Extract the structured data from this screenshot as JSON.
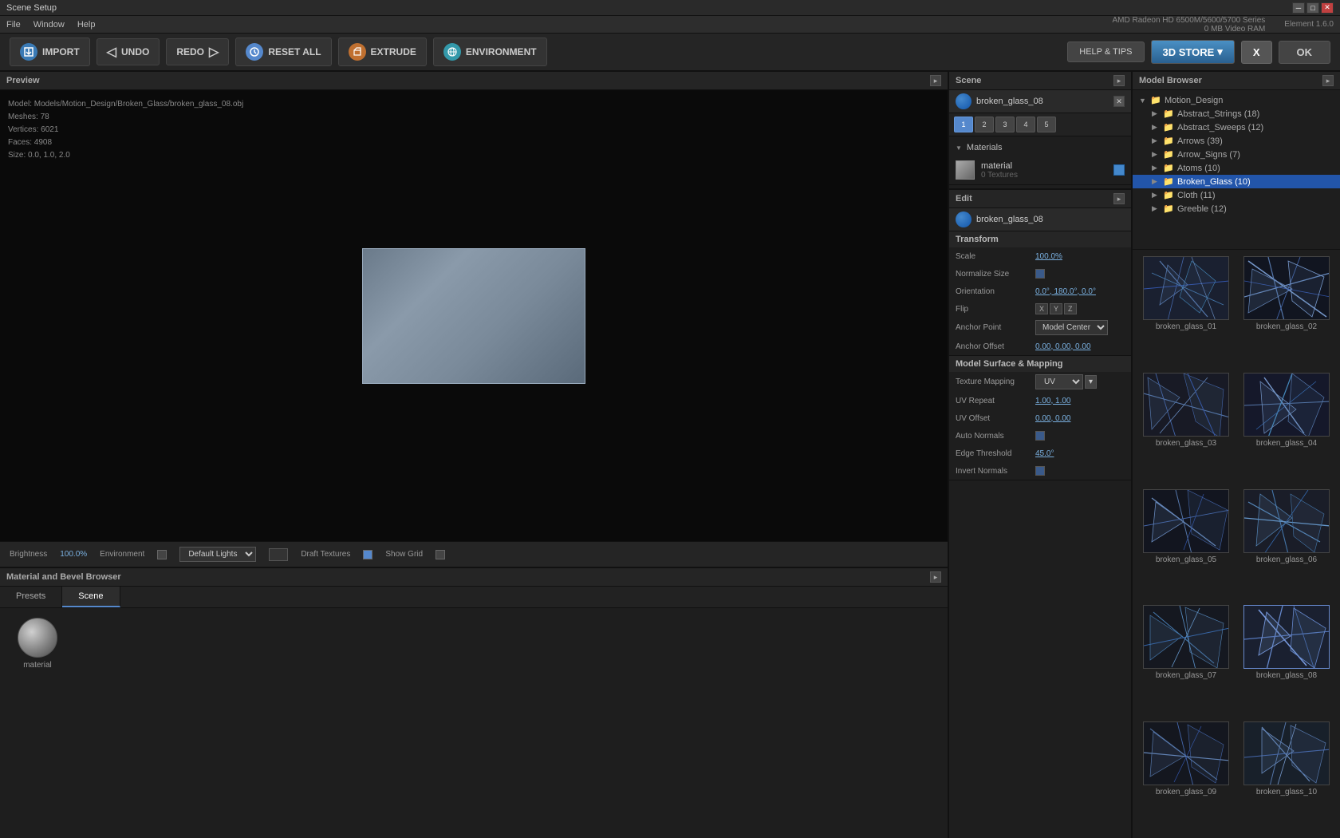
{
  "window": {
    "title": "Scene Setup",
    "gpu": "AMD Radeon HD 6500M/5600/5700 Series",
    "vram": "0 MB Video RAM",
    "element_version": "Element 1.6.0"
  },
  "menu": {
    "items": [
      "File",
      "Window",
      "Help"
    ]
  },
  "toolbar": {
    "import_label": "IMPORT",
    "undo_label": "UNDO",
    "redo_label": "REDO",
    "reset_label": "RESET ALL",
    "extrude_label": "EXTRUDE",
    "env_label": "ENVIRONMENT",
    "help_label": "HELP & TIPS",
    "store_label": "3D STORE",
    "x_label": "X",
    "ok_label": "OK"
  },
  "preview": {
    "title": "Preview",
    "model_path": "Model: Models/Motion_Design/Broken_Glass/broken_glass_08.obj",
    "meshes": "Meshes: 78",
    "vertices": "Vertices: 6021",
    "faces": "Faces: 4908",
    "size": "Size: 0.0, 1.0, 2.0",
    "brightness_label": "Brightness",
    "brightness_value": "100.0%",
    "environment_label": "Environment",
    "lights_value": "Default Lights",
    "draft_textures_label": "Draft Textures",
    "show_grid_label": "Show Grid"
  },
  "material_browser": {
    "title": "Material and Bevel Browser",
    "tabs": [
      "Presets",
      "Scene"
    ],
    "active_tab": "Scene",
    "material_name": "material"
  },
  "scene": {
    "title": "Scene",
    "object_name": "broken_glass_08",
    "tabs": [
      "1",
      "2",
      "3",
      "4",
      "5"
    ],
    "active_tab": "1",
    "materials_label": "Materials",
    "material_name": "material",
    "material_textures": "0 Textures"
  },
  "edit": {
    "title": "Edit",
    "object_name": "broken_glass_08",
    "transform_label": "Transform",
    "scale_label": "Scale",
    "scale_value": "100.0%",
    "normalize_label": "Normalize Size",
    "orientation_label": "Orientation",
    "orientation_value": "0.0°, 180.0°, 0.0°",
    "flip_label": "Flip",
    "flip_x": "X",
    "flip_y": "Y",
    "flip_z": "Z",
    "anchor_label": "Anchor Point",
    "anchor_value": "Model Center",
    "anchor_offset_label": "Anchor Offset",
    "anchor_offset_value": "0.00, 0.00, 0.00",
    "surface_mapping_title": "Model Surface & Mapping",
    "texture_mapping_label": "Texture Mapping",
    "texture_mapping_value": "UV",
    "uv_repeat_label": "UV Repeat",
    "uv_repeat_value": "1.00, 1.00",
    "uv_offset_label": "UV Offset",
    "uv_offset_value": "0.00, 0.00",
    "auto_normals_label": "Auto Normals",
    "edge_threshold_label": "Edge Threshold",
    "edge_threshold_value": "45.0°",
    "invert_normals_label": "Invert Normals"
  },
  "model_browser": {
    "title": "Model Browser",
    "tree": [
      {
        "name": "Motion_Design",
        "type": "folder",
        "expanded": true,
        "level": 0
      },
      {
        "name": "Abstract_Strings (18)",
        "type": "folder",
        "expanded": false,
        "level": 1
      },
      {
        "name": "Abstract_Sweeps (12)",
        "type": "folder",
        "expanded": false,
        "level": 1
      },
      {
        "name": "Arrows (39)",
        "type": "folder",
        "expanded": false,
        "level": 1
      },
      {
        "name": "Arrow_Signs (7)",
        "type": "folder",
        "expanded": false,
        "level": 1
      },
      {
        "name": "Atoms (10)",
        "type": "folder",
        "expanded": false,
        "level": 1
      },
      {
        "name": "Broken_Glass (10)",
        "type": "folder",
        "expanded": false,
        "level": 1,
        "selected": true
      },
      {
        "name": "Cloth (11)",
        "type": "folder",
        "expanded": false,
        "level": 1
      },
      {
        "name": "Greeble (12)",
        "type": "folder",
        "expanded": false,
        "level": 1
      }
    ],
    "thumbnails": [
      {
        "name": "broken_glass_01"
      },
      {
        "name": "broken_glass_02"
      },
      {
        "name": "broken_glass_03"
      },
      {
        "name": "broken_glass_04"
      },
      {
        "name": "broken_glass_05"
      },
      {
        "name": "broken_glass_06"
      },
      {
        "name": "broken_glass_07"
      },
      {
        "name": "broken_glass_08"
      },
      {
        "name": "broken_glass_09"
      },
      {
        "name": "broken_glass_10"
      }
    ]
  }
}
